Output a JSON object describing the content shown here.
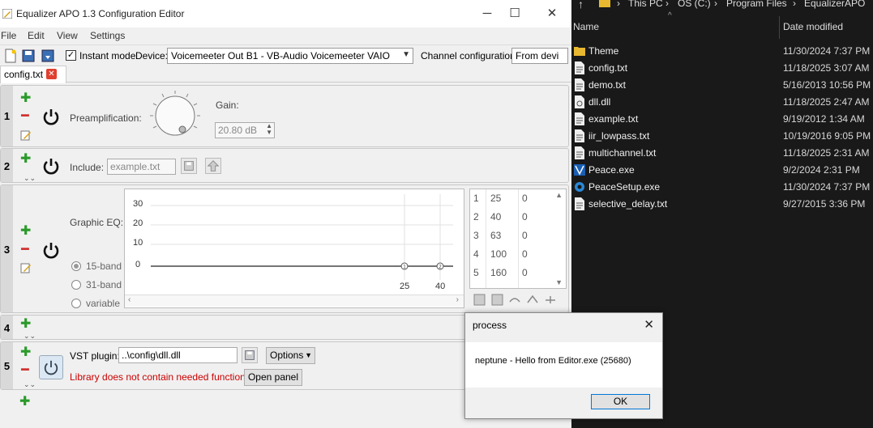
{
  "window": {
    "title": "Equalizer APO 1.3 Configuration Editor",
    "minimize": "─",
    "maximize": "☐",
    "close": "✕"
  },
  "menu": [
    "File",
    "Edit",
    "View",
    "Settings"
  ],
  "toolbar": {
    "instant_mode_label": "Instant mode",
    "instant_mode_checked": "✓",
    "device_label": "Device:",
    "device_value": "Voicemeeter Out B1 - VB-Audio Voicemeeter VAIO",
    "channel_label": "Channel configuration:",
    "channel_value": "From devi"
  },
  "tab": {
    "label": "config.txt",
    "close": "✕"
  },
  "rows": {
    "r1": {
      "num": "1",
      "label": "Preamplification:",
      "gain_label": "Gain:",
      "gain_value": "20.80 dB"
    },
    "r2": {
      "num": "2",
      "label": "Include:",
      "value": "example.txt"
    },
    "r3": {
      "num": "3",
      "label": "Graphic EQ:",
      "modes": [
        "15-band",
        "31-band",
        "variable"
      ],
      "y_ticks": [
        "30",
        "20",
        "10",
        "0"
      ],
      "x_ticks": [
        "25",
        "40"
      ],
      "bands": [
        {
          "idx": "1",
          "freq": "25",
          "gain": "0"
        },
        {
          "idx": "2",
          "freq": "40",
          "gain": "0"
        },
        {
          "idx": "3",
          "freq": "63",
          "gain": "0"
        },
        {
          "idx": "4",
          "freq": "100",
          "gain": "0"
        },
        {
          "idx": "5",
          "freq": "160",
          "gain": "0"
        }
      ]
    },
    "r4": {
      "num": "4"
    },
    "r5": {
      "num": "5",
      "label": "VST plugin:",
      "path": "..\\config\\dll.dll",
      "options": "Options",
      "error": "Library does not contain needed functions.",
      "open_panel": "Open panel"
    }
  },
  "explorer": {
    "breadcrumb": [
      "This PC",
      "OS (C:)",
      "Program Files",
      "EqualizerAPO"
    ],
    "col_name": "Name",
    "col_date": "Date modified",
    "files": [
      {
        "name": "Theme",
        "date": "11/30/2024 7:37 PM",
        "icon": "folder-icon"
      },
      {
        "name": "config.txt",
        "date": "11/18/2025 3:07 AM",
        "icon": "text-file-icon"
      },
      {
        "name": "demo.txt",
        "date": "5/16/2013 10:56 PM",
        "icon": "text-file-icon"
      },
      {
        "name": "dll.dll",
        "date": "11/18/2025 2:47 AM",
        "icon": "dll-file-icon"
      },
      {
        "name": "example.txt",
        "date": "9/19/2012 1:34 AM",
        "icon": "text-file-icon"
      },
      {
        "name": "iir_lowpass.txt",
        "date": "10/19/2016 9:05 PM",
        "icon": "text-file-icon"
      },
      {
        "name": "multichannel.txt",
        "date": "11/18/2025 2:31 AM",
        "icon": "text-file-icon"
      },
      {
        "name": "Peace.exe",
        "date": "9/2/2024 2:31 PM",
        "icon": "peace-app-icon"
      },
      {
        "name": "PeaceSetup.exe",
        "date": "11/30/2024 7:37 PM",
        "icon": "setup-gear-icon"
      },
      {
        "name": "selective_delay.txt",
        "date": "9/27/2015 3:36 PM",
        "icon": "text-file-icon"
      }
    ]
  },
  "dialog": {
    "title": "process",
    "message": "neptune - Hello from Editor.exe (25680)",
    "ok": "OK",
    "close": "✕"
  },
  "colors": {
    "accent_blue": "#0078d7",
    "error_red": "#cc0000",
    "explorer_bg": "#191919"
  }
}
